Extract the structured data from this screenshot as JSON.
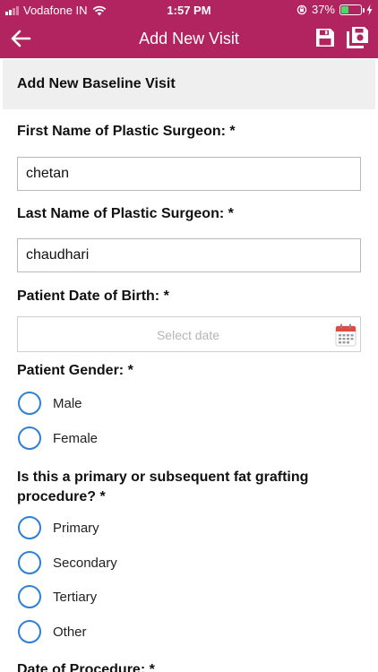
{
  "status_bar": {
    "carrier": "Vodafone IN",
    "time": "1:57 PM",
    "battery": "37%",
    "battery_level": 0.37,
    "wifi_icon": "wifi-icon",
    "lock_icon": "orientation-lock-icon",
    "charging_icon": "charging-bolt-icon"
  },
  "header": {
    "title": "Add New Visit",
    "back_icon": "arrow-left-icon",
    "save_icon": "floppy-disk-icon",
    "save_all_icon": "save-all-icon",
    "background_color": "#b1245f"
  },
  "section": {
    "title": "Add New Baseline Visit"
  },
  "form": {
    "first_name": {
      "label": "First Name of Plastic Surgeon: *",
      "value": "chetan"
    },
    "last_name": {
      "label": "Last Name of Plastic Surgeon: *",
      "value": "chaudhari"
    },
    "dob": {
      "label": "Patient Date of Birth: *",
      "placeholder": "Select date",
      "icon": "calendar-icon"
    },
    "gender": {
      "label": "Patient Gender: *",
      "options": [
        "Male",
        "Female"
      ]
    },
    "procedure": {
      "label": "Is this a primary or subsequent fat grafting procedure? *",
      "options": [
        "Primary",
        "Secondary",
        "Tertiary",
        "Other"
      ]
    },
    "procedure_date": {
      "label": "Date of Procedure: *"
    }
  },
  "colors": {
    "accent": "#b1245f",
    "radio": "#2f7fd4"
  }
}
